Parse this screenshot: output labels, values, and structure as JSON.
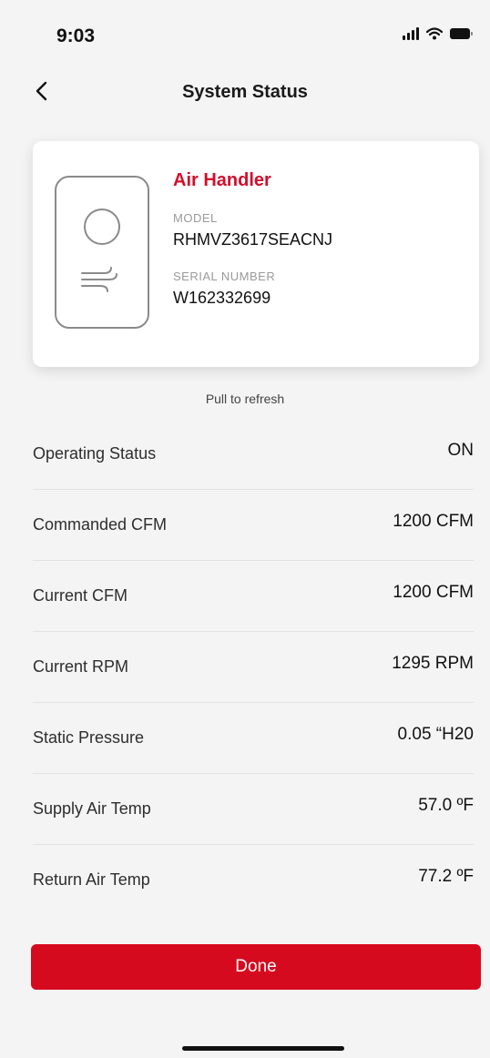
{
  "status_bar": {
    "time": "9:03"
  },
  "nav": {
    "title": "System Status"
  },
  "device": {
    "name": "Air Handler",
    "model_label": "MODEL",
    "model": "RHMVZ3617SEACNJ",
    "serial_label": "SERIAL NUMBER",
    "serial": "W162332699"
  },
  "refresh_hint": "Pull to refresh",
  "rows": [
    {
      "label": "Operating Status",
      "value": "ON"
    },
    {
      "label": "Commanded CFM",
      "value": "1200 CFM"
    },
    {
      "label": "Current CFM",
      "value": "1200 CFM"
    },
    {
      "label": "Current RPM",
      "value": "1295 RPM"
    },
    {
      "label": "Static Pressure",
      "value": "0.05 “H20"
    },
    {
      "label": "Supply Air Temp",
      "value": "57.0 ºF"
    },
    {
      "label": "Return Air Temp",
      "value": "77.2 ºF"
    }
  ],
  "done_label": "Done",
  "colors": {
    "accent": "#d60a1e",
    "title_red": "#d0102c"
  }
}
